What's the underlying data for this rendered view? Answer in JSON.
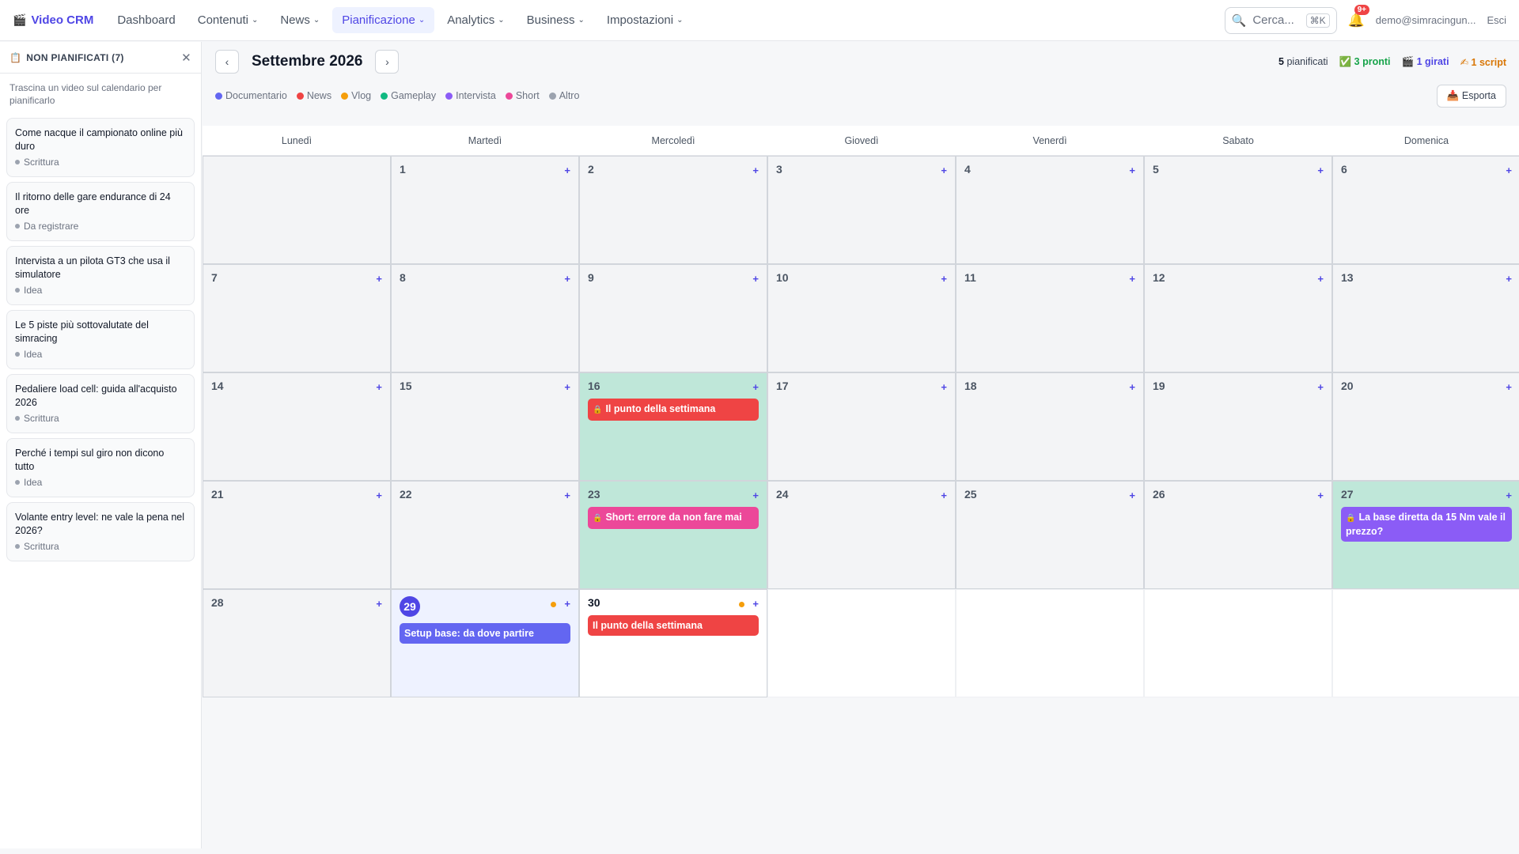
{
  "nav": {
    "brand": "Video CRM",
    "items": [
      {
        "label": "Dashboard",
        "dropdown": false,
        "active": false
      },
      {
        "label": "Contenuti",
        "dropdown": true,
        "active": false
      },
      {
        "label": "News",
        "dropdown": true,
        "active": false
      },
      {
        "label": "Pianificazione",
        "dropdown": true,
        "active": true
      },
      {
        "label": "Analytics",
        "dropdown": true,
        "active": false
      },
      {
        "label": "Business",
        "dropdown": true,
        "active": false
      },
      {
        "label": "Impostazioni",
        "dropdown": true,
        "active": false
      }
    ],
    "search_placeholder": "Cerca...",
    "search_shortcut": "⌘K",
    "notifications": "9+",
    "user": "demo@simracingun...",
    "logout": "Esci"
  },
  "sidebar": {
    "title": "NON PIANIFICATI (7)",
    "hint": "Trascina un video sul calendario per pianificarlo",
    "cards": [
      {
        "title": "Come nacque il campionato online più duro",
        "status": "Scrittura"
      },
      {
        "title": "Il ritorno delle gare endurance di 24 ore",
        "status": "Da registrare"
      },
      {
        "title": "Intervista a un pilota GT3 che usa il simulatore",
        "status": "Idea"
      },
      {
        "title": "Le 5 piste più sottovalutate del simracing",
        "status": "Idea"
      },
      {
        "title": "Pedaliere load cell: guida all'acquisto 2026",
        "status": "Scrittura"
      },
      {
        "title": "Perché i tempi sul giro non dicono tutto",
        "status": "Idea"
      },
      {
        "title": "Volante entry level: ne vale la pena nel 2026?",
        "status": "Scrittura"
      }
    ]
  },
  "toolbar": {
    "month": "Settembre 2026",
    "stat_planned_num": "5",
    "stat_planned_label": "pianificati",
    "stat_ready": "3 pronti",
    "stat_shot": "1 girati",
    "stat_script": "1 script",
    "export": "Esporta"
  },
  "legend": [
    {
      "label": "Documentario",
      "color": "#6366f1"
    },
    {
      "label": "News",
      "color": "#ef4444"
    },
    {
      "label": "Vlog",
      "color": "#f59e0b"
    },
    {
      "label": "Gameplay",
      "color": "#10b981"
    },
    {
      "label": "Intervista",
      "color": "#8b5cf6"
    },
    {
      "label": "Short",
      "color": "#ec4899"
    },
    {
      "label": "Altro",
      "color": "#9ca3af"
    }
  ],
  "weekdays": [
    "Lunedì",
    "Martedì",
    "Mercoledì",
    "Giovedì",
    "Venerdì",
    "Sabato",
    "Domenica"
  ],
  "calendar": {
    "leading_empty": 1,
    "days": 30,
    "trailing_empty": 4,
    "today": 29,
    "green_days": [
      16,
      23,
      27
    ],
    "dark_days": [
      30
    ],
    "orange_dot_days": [
      29,
      30
    ],
    "events": [
      {
        "day": 16,
        "title": "Il punto della settimana",
        "color": "#ef4444",
        "locked": true
      },
      {
        "day": 23,
        "title": "Short: errore da non fare mai",
        "color": "#ec4899",
        "locked": true
      },
      {
        "day": 27,
        "title": "La base diretta da 15 Nm vale il prezzo?",
        "color": "#8b5cf6",
        "locked": true
      },
      {
        "day": 29,
        "title": "Setup base: da dove partire",
        "color": "#6366f1",
        "locked": false
      },
      {
        "day": 30,
        "title": "Il punto della settimana",
        "color": "#ef4444",
        "locked": false
      }
    ]
  }
}
